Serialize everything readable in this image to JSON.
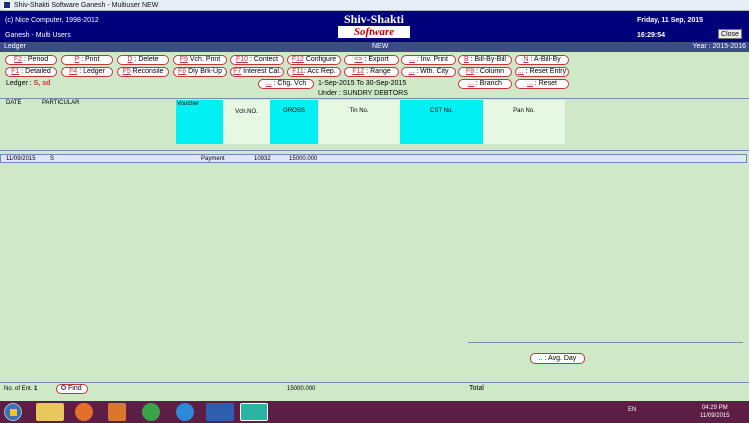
{
  "window": {
    "title": "Shiv-Shakti Software     Ganesh - Multiuser  NEW"
  },
  "header": {
    "copyright": "(c) Nice Computer, 1998-2012",
    "user": "Ganesh - Multi Users",
    "logo_top": "Shiv-Shakti",
    "logo_bottom": "Software",
    "date": "Friday, 11 Sep, 2015",
    "time": "16:29:54",
    "close_label": "Close",
    "colors": {
      "band": "#00007a",
      "logo_red": "#c20000"
    }
  },
  "ledgerbar": {
    "title": "Ledger",
    "mode": "NEW",
    "year": "Year : 2015-2016"
  },
  "buttons_row1": [
    {
      "key": "F2",
      "label": " : Period"
    },
    {
      "key": "P",
      "label": " : Print"
    },
    {
      "key": "D",
      "label": " : Delete"
    },
    {
      "key": "F9",
      "label": " Vch. Print"
    },
    {
      "key": "F10",
      "label": " : Contect"
    },
    {
      "key": "F12",
      "label": " Configure"
    },
    {
      "key": "<>",
      "label": " : Export"
    },
    {
      "key": "...",
      "label": " : Inv. Print"
    },
    {
      "key": "B",
      "label": " : Bill-By-Bill"
    },
    {
      "key": "N",
      "label": " : A-Bill-By"
    }
  ],
  "buttons_row2": [
    {
      "key": "F1",
      "label": " : Detailed"
    },
    {
      "key": "F4",
      "label": " : Ledger"
    },
    {
      "key": "F5",
      "label": " Reconsile"
    },
    {
      "key": "F6",
      "label": " Dly Brk-Up"
    },
    {
      "key": "F7",
      "label": " Interest Cal."
    },
    {
      "key": "F11",
      "label": ": Acc Rep."
    },
    {
      "key": "F12",
      "label": " : Range"
    },
    {
      "key": "...",
      "label": " : Wth. City"
    },
    {
      "key": "F8",
      "label": " : Column"
    },
    {
      "key": "...",
      "label": " : Reset Entry"
    }
  ],
  "buttons_row3": [
    {
      "key": "...",
      "label": " : Chg. Vch"
    },
    {
      "key": "...",
      "label": " : Branch"
    },
    {
      "key": "...",
      "label": " : Reset"
    }
  ],
  "ledger": {
    "label": "Ledger :",
    "value": "S, sd"
  },
  "period": "1-Sep-2015 To 30-Sep-2015",
  "under": "Under : SUNDRY DEBTORS",
  "columns": {
    "date": "DATE",
    "particular": "PARTICULAR",
    "voucher": "Voucher",
    "vch_no": "Vch.NO.",
    "gross": "GROSS",
    "tin": "Tin No.",
    "cst": "CST No.",
    "pan": "Pan No."
  },
  "rows": [
    {
      "date": "11/09/2015",
      "particular": "S",
      "voucher": "Payment",
      "vch_no": "10932",
      "gross": "15000.000"
    }
  ],
  "avg_day": ".. : Avg. Day",
  "footer": {
    "entries_label": "No. of Ent.",
    "entries_value": "1",
    "find_label": "Find",
    "gross_total": "15000.000",
    "total_label": "Total"
  },
  "taskbar": {
    "language": "EN",
    "clock_time": "04:29 PM",
    "clock_date": "11/09/2015",
    "apps": [
      "file-explorer-icon",
      "firefox-icon",
      "media-player-icon",
      "chrome-icon",
      "internet-explorer-icon",
      "word-icon",
      "shiv-shakti-icon"
    ]
  }
}
